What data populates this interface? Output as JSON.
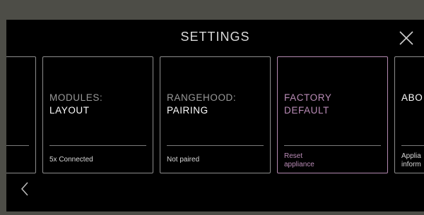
{
  "header": {
    "title": "SETTINGS",
    "close_icon": "close-icon"
  },
  "cards": [
    {
      "title_line1": "",
      "title_line2": "",
      "status": ""
    },
    {
      "title_line1": "MODULES:",
      "title_line2": "LAYOUT",
      "status": "5x Connected"
    },
    {
      "title_line1": "RANGEHOOD:",
      "title_line2": "PAIRING",
      "status": "Not paired"
    },
    {
      "title_line1": "FACTORY",
      "title_line2": "DEFAULT",
      "status_line1": "Reset",
      "status_line2": "appliance",
      "selected": true
    },
    {
      "title_line1": "ABO",
      "status_line1": "Applia",
      "status_line2": "inform"
    }
  ],
  "navigation": {
    "back_icon": "chevron-left-icon"
  },
  "colors": {
    "background": "#000000",
    "frame": "#4d4d47",
    "border": "#8d8d8d",
    "accent": "#b98bb6",
    "muted_text": "#9a9a9a"
  }
}
